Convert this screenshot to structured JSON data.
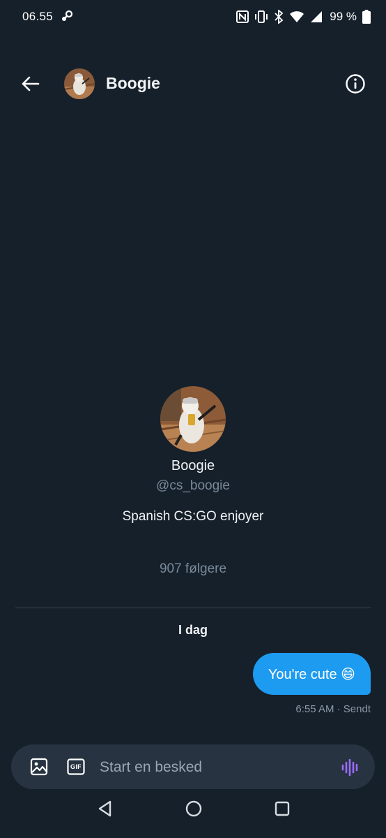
{
  "status_bar": {
    "time": "06.55",
    "battery": "99 %"
  },
  "header": {
    "name": "Boogie"
  },
  "profile": {
    "name": "Boogie",
    "handle": "@cs_boogie",
    "bio": "Spanish CS:GO enjoyer",
    "followers": "907 følgere"
  },
  "conversation": {
    "day_label": "I dag",
    "messages": [
      {
        "text": "You're cute 😄",
        "meta": "6:55 AM · Sendt"
      }
    ]
  },
  "composer": {
    "placeholder": "Start en besked",
    "gif_label": "GIF"
  },
  "colors": {
    "background": "#16202b",
    "bubble": "#1d9bf0",
    "composer": "#273340",
    "voice_accent": "#9b6bff"
  },
  "icons": [
    "steam-icon",
    "nfc-icon",
    "vibrate-icon",
    "bluetooth-icon",
    "wifi-icon",
    "signal-icon",
    "battery-icon",
    "back-arrow-icon",
    "info-icon",
    "image-icon",
    "gif-icon",
    "voice-icon",
    "nav-back-icon",
    "nav-home-icon",
    "nav-recents-icon"
  ]
}
